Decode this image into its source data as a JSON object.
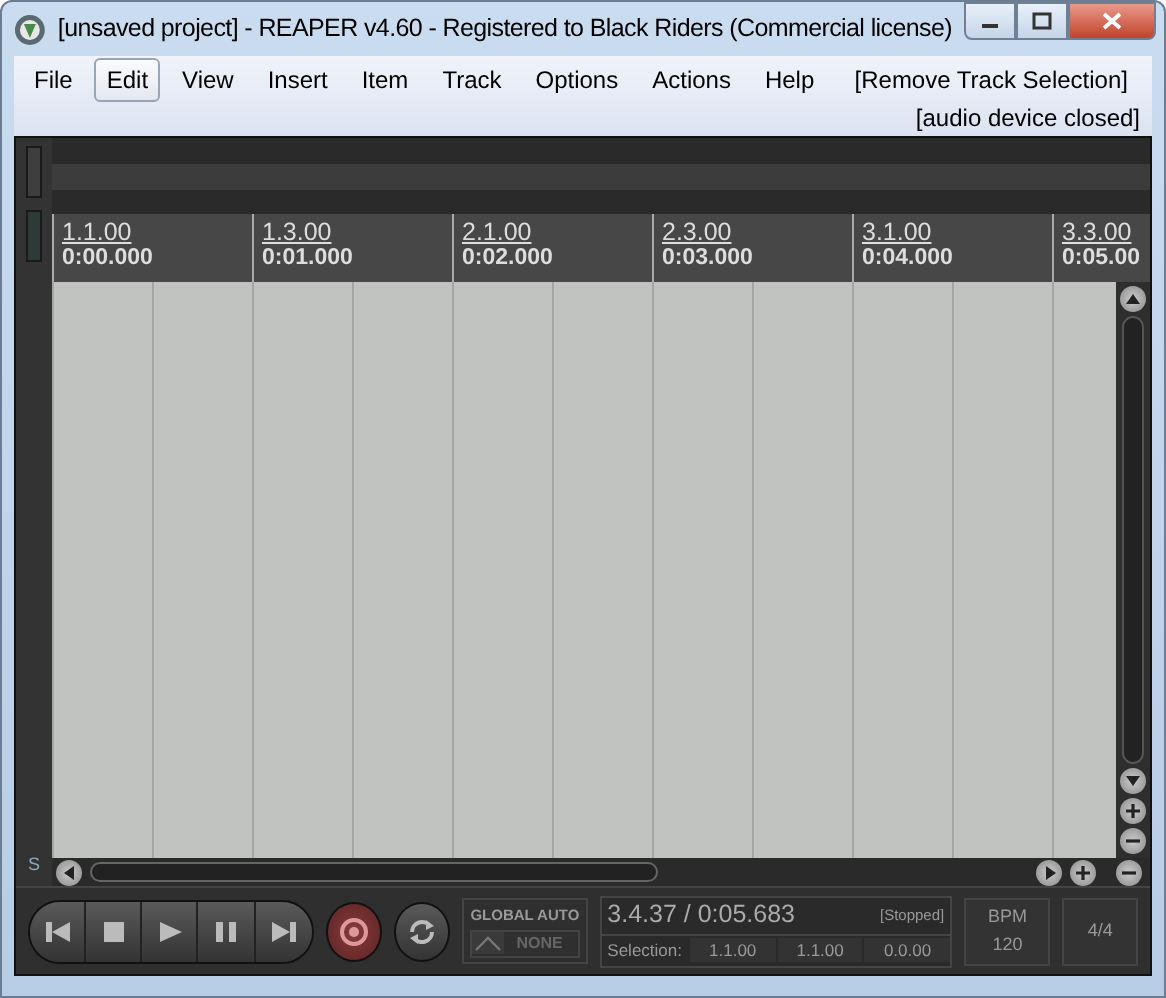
{
  "window": {
    "title": "[unsaved project] - REAPER v4.60 - Registered to Black Riders (Commercial license)"
  },
  "menu": [
    {
      "label": "File",
      "selected": false
    },
    {
      "label": "Edit",
      "selected": true
    },
    {
      "label": "View",
      "selected": false
    },
    {
      "label": "Insert",
      "selected": false
    },
    {
      "label": "Item",
      "selected": false
    },
    {
      "label": "Track",
      "selected": false
    },
    {
      "label": "Options",
      "selected": false
    },
    {
      "label": "Actions",
      "selected": false
    },
    {
      "label": "Help",
      "selected": false
    }
  ],
  "menu_action": "[Remove Track Selection]",
  "audio_status": "[audio device closed]",
  "ruler": [
    {
      "bar": "1.1.00",
      "time": "0:00.000"
    },
    {
      "bar": "1.3.00",
      "time": "0:01.000"
    },
    {
      "bar": "2.1.00",
      "time": "0:02.000"
    },
    {
      "bar": "2.3.00",
      "time": "0:03.000"
    },
    {
      "bar": "3.1.00",
      "time": "0:04.000"
    },
    {
      "bar": "3.3.00",
      "time": "0:05.00"
    }
  ],
  "left_strip_label": "S",
  "transport": [
    {
      "kind": "start"
    },
    {
      "kind": "stop"
    },
    {
      "kind": "play"
    },
    {
      "kind": "pause"
    },
    {
      "kind": "end"
    },
    {
      "kind": "record"
    },
    {
      "kind": "repeat"
    }
  ],
  "global_auto": {
    "title": "GLOBAL AUTO",
    "mode": "NONE"
  },
  "position": "3.4.37 / 0:05.683",
  "play_state": "[Stopped]",
  "selection": {
    "label": "Selection:",
    "start": "1.1.00",
    "end": "1.1.00",
    "length": "0.0.00"
  },
  "tempo": {
    "label": "BPM",
    "value": "120"
  },
  "time_signature": "4/4"
}
